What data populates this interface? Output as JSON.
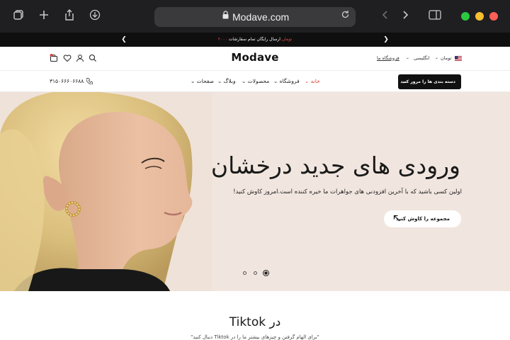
{
  "browser": {
    "url": "Modave.com",
    "icons": {
      "tabs": "tabs-icon",
      "new_tab": "plus-icon",
      "share": "share-icon",
      "downloads": "download-icon",
      "reload": "reload-icon",
      "back": "back-icon",
      "forward": "forward-icon",
      "sidebar": "sidebar-icon"
    },
    "traffic_colors": {
      "green": "#2bc840",
      "yellow": "#f5bf30",
      "red": "#fe5f57"
    }
  },
  "announcement": {
    "text": "ارسال رایگان تمام سفارشات",
    "highlight": "۲۰۰۰ تومان"
  },
  "header": {
    "logo": "Modave",
    "currency": "تومان",
    "language": "انگلیسی",
    "store_link": "فروشگاه ما"
  },
  "nav": {
    "category_button": "دسته بندی ها را مرور کنید",
    "items": [
      {
        "label": "خانه",
        "active": true
      },
      {
        "label": "فروشگاه"
      },
      {
        "label": "محصولات"
      },
      {
        "label": "وبلاگ"
      },
      {
        "label": "صفحات"
      }
    ],
    "phone": "۳۱۵۰۶۶۶۰۶۶۸۸"
  },
  "hero": {
    "title": "ورودی های جدید درخشان",
    "subtitle": "اولین کسی باشید که با آخرین افزودنی های جواهرات ما خیره کننده است.امروز کاوش کنید!",
    "button": "مجموعه را کاوش کنید",
    "slide_count": 3,
    "active_slide": 3
  },
  "section": {
    "title": "در Tiktok",
    "subtitle": "\"برای الهام گرفتن و چیزهای بیشتر ما را در Tiktok دنبال کنید\""
  },
  "colors": {
    "accent": "#e0443a",
    "hero_bg": "#f1e6df"
  }
}
